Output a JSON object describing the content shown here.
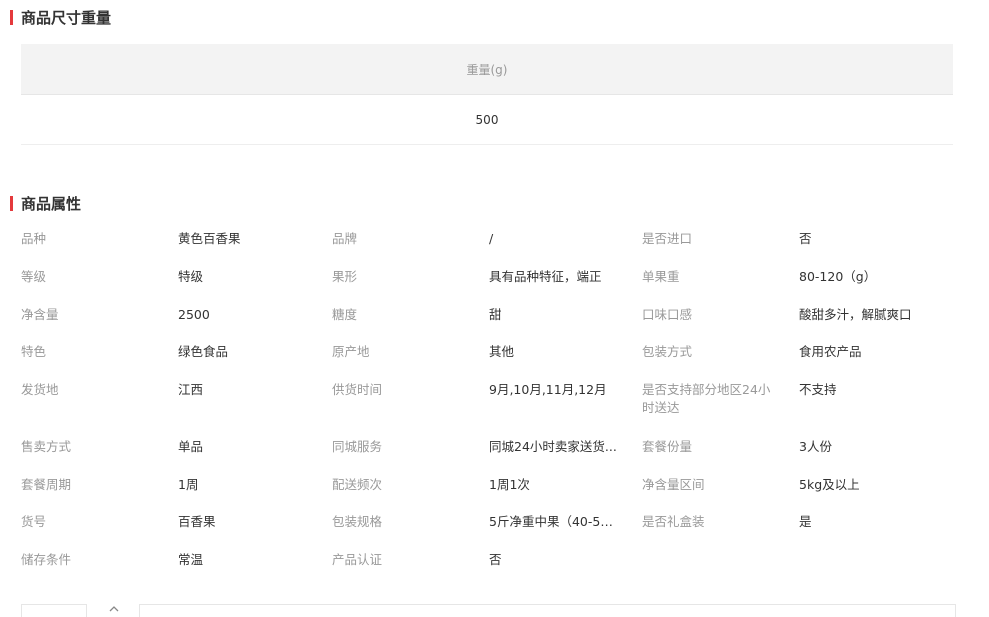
{
  "size_section": {
    "title": "商品尺寸重量",
    "header": "重量(g)",
    "value": "500"
  },
  "attr_section": {
    "title": "商品属性",
    "rows": [
      {
        "items": [
          {
            "k": "品种",
            "v": "黄色百香果"
          },
          {
            "k": "品牌",
            "v": "/"
          },
          {
            "k": "是否进口",
            "v": "否"
          }
        ]
      },
      {
        "items": [
          {
            "k": "等级",
            "v": "特级"
          },
          {
            "k": "果形",
            "v": "具有品种特征，端正"
          },
          {
            "k": "单果重",
            "v": "80-120（g）"
          }
        ]
      },
      {
        "items": [
          {
            "k": "净含量",
            "v": "2500"
          },
          {
            "k": "糖度",
            "v": "甜"
          },
          {
            "k": "口味口感",
            "v": "酸甜多汁，解腻爽口"
          }
        ]
      },
      {
        "items": [
          {
            "k": "特色",
            "v": "绿色食品"
          },
          {
            "k": "原产地",
            "v": "其他"
          },
          {
            "k": "包装方式",
            "v": "食用农产品"
          }
        ]
      },
      {
        "items": [
          {
            "k": "发货地",
            "v": "江西"
          },
          {
            "k": "供货时间",
            "v": "9月,10月,11月,12月"
          },
          {
            "k": "是否支持部分地区24小时送达",
            "v": "不支持"
          }
        ]
      },
      {
        "items": [
          {
            "k": "售卖方式",
            "v": "单品"
          },
          {
            "k": "同城服务",
            "v": "同城24小时卖家送货..."
          },
          {
            "k": "套餐份量",
            "v": "3人份"
          }
        ]
      },
      {
        "items": [
          {
            "k": "套餐周期",
            "v": "1周"
          },
          {
            "k": "配送频次",
            "v": "1周1次"
          },
          {
            "k": "净含量区间",
            "v": "5kg及以上"
          }
        ]
      },
      {
        "items": [
          {
            "k": "货号",
            "v": "百香果"
          },
          {
            "k": "包装规格",
            "v": "5斤净重中果（40-55..."
          },
          {
            "k": "是否礼盒装",
            "v": "是"
          }
        ]
      },
      {
        "items": [
          {
            "k": "储存条件",
            "v": "常温"
          },
          {
            "k": "产品认证",
            "v": "否"
          }
        ]
      }
    ]
  },
  "colors": {
    "accent": "#e4393c",
    "label": "#999999",
    "value": "#333333",
    "header_bg": "#f3f3f3"
  },
  "icons": {
    "collapse": "chevron-up-icon"
  }
}
